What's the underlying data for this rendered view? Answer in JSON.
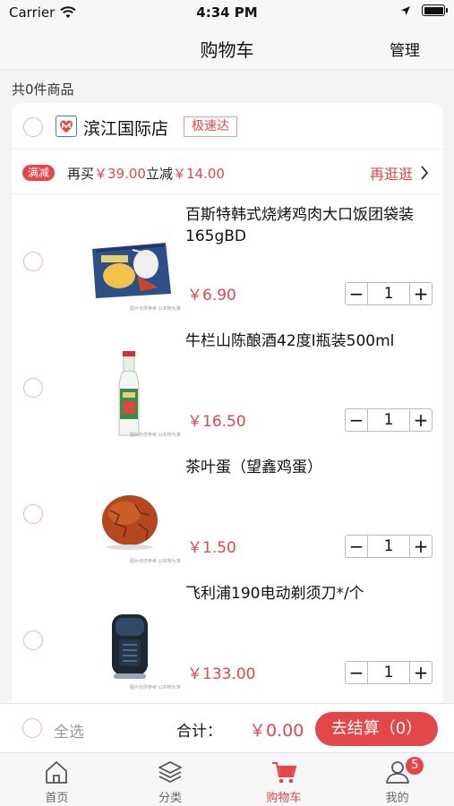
{
  "status_bar": {
    "carrier": "Carrier",
    "time": "4:34 PM"
  },
  "nav": {
    "title": "购物车",
    "manage": "管理"
  },
  "cart": {
    "count_text": "共0件商品"
  },
  "store": {
    "name": "滨江国际店",
    "badge": "极速达"
  },
  "promo": {
    "tag": "满减",
    "text_1": "再买",
    "amount_1": "￥39.00",
    "text_2": "立减",
    "amount_2": "￥14.00",
    "link": "再逛逛"
  },
  "items": [
    {
      "title": "百斯特韩式烧烤鸡肉大口饭团袋装165gBD",
      "price": "￥6.90",
      "qty": "1",
      "image": "rice-ball-package"
    },
    {
      "title": "牛栏山陈酿酒42度I瓶装500ml",
      "price": "￥16.50",
      "qty": "1",
      "image": "liquor-bottle"
    },
    {
      "title": "茶叶蛋（望鑫鸡蛋）",
      "price": "￥1.50",
      "qty": "1",
      "image": "tea-egg"
    },
    {
      "title": "飞利浦190电动剃须刀*/个",
      "price": "￥133.00",
      "qty": "1",
      "image": "electric-shaver"
    }
  ],
  "checkout": {
    "select_all": "全选",
    "total_label": "合计：",
    "total_value": "￥0.00",
    "button": "去结算（0）"
  },
  "tabs": [
    {
      "label": "首页",
      "icon": "home-icon"
    },
    {
      "label": "分类",
      "icon": "layers-icon"
    },
    {
      "label": "购物车",
      "icon": "cart-icon",
      "active": true
    },
    {
      "label": "我的",
      "icon": "user-icon",
      "badge": "5"
    }
  ],
  "colors": {
    "accent": "#e4474a",
    "background": "#f4f4f4"
  }
}
